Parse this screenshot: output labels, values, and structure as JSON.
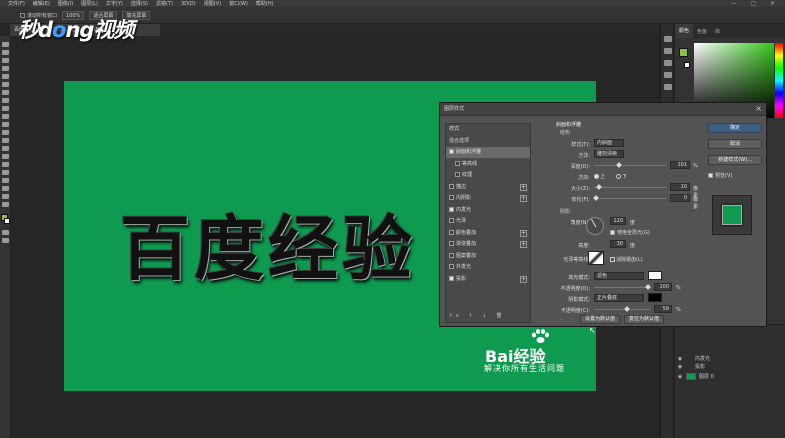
{
  "menubar": {
    "items": [
      "文件(F)",
      "编辑(E)",
      "图像(I)",
      "图层(L)",
      "文字(Y)",
      "选择(S)",
      "滤镜(T)",
      "3D(D)",
      "视图(V)",
      "窗口(W)",
      "帮助(H)"
    ],
    "window_controls": "— ▢ ✕"
  },
  "options": {
    "auto_scroll_label": "滚动所有窗口",
    "zoom_value": "100%",
    "fit_screen_label": "适合屏幕",
    "fill_screen_label": "填充屏幕"
  },
  "watermark": {
    "part1": "秒",
    "part2": "d",
    "part3": "o",
    "part4": "ng视频"
  },
  "document": {
    "tab_label": "百度经验.psd @ 100% (图层 1, RGB/8#) *"
  },
  "canvas": {
    "headline": "百度经验",
    "logo_text": "Bai经验",
    "slogan": "解决你所有生活问题",
    "background_color": "#0e9a4f"
  },
  "color_panel": {
    "tabs": [
      "颜色",
      "色板",
      "库"
    ],
    "foreground": "#8ac53f",
    "background": "#ffffff"
  },
  "layers": {
    "rows": [
      {
        "name": "内发光"
      },
      {
        "name": "投影"
      },
      {
        "name": "图层 0"
      }
    ]
  },
  "dialog": {
    "title": "图层样式",
    "close": "×",
    "styles_header": "样式",
    "blend_options": "混合选项",
    "styles": [
      {
        "label": "斜面和浮雕",
        "checked": true,
        "selected": true,
        "indent": false,
        "plus": false
      },
      {
        "label": "等高线",
        "checked": false,
        "selected": false,
        "indent": true,
        "plus": false
      },
      {
        "label": "纹理",
        "checked": false,
        "selected": false,
        "indent": true,
        "plus": false
      },
      {
        "label": "描边",
        "checked": false,
        "selected": false,
        "indent": false,
        "plus": true
      },
      {
        "label": "内阴影",
        "checked": false,
        "selected": false,
        "indent": false,
        "plus": true
      },
      {
        "label": "内发光",
        "checked": true,
        "selected": false,
        "indent": false,
        "plus": false
      },
      {
        "label": "光泽",
        "checked": false,
        "selected": false,
        "indent": false,
        "plus": false
      },
      {
        "label": "颜色叠加",
        "checked": false,
        "selected": false,
        "indent": false,
        "plus": true
      },
      {
        "label": "渐变叠加",
        "checked": false,
        "selected": false,
        "indent": false,
        "plus": true
      },
      {
        "label": "图案叠加",
        "checked": false,
        "selected": false,
        "indent": false,
        "plus": false
      },
      {
        "label": "外发光",
        "checked": false,
        "selected": false,
        "indent": false,
        "plus": false
      },
      {
        "label": "投影",
        "checked": true,
        "selected": false,
        "indent": false,
        "plus": true
      }
    ],
    "footer_icons": "fx ↑ ↓ 🗑",
    "section_title": "斜面和浮雕",
    "structure_title": "结构",
    "style_label": "样式(T):",
    "style_value": "内斜面",
    "technique_label": "方法:",
    "technique_value": "雕刻清晰",
    "depth_label": "深度(D):",
    "depth_value": "101",
    "depth_unit": "%",
    "direction_label": "方向:",
    "dir_up": "上",
    "dir_down": "下",
    "size_label": "大小(Z):",
    "size_value": "10",
    "size_unit": "像素",
    "soften_label": "软化(F):",
    "soften_value": "0",
    "soften_unit": "像素",
    "shading_title": "阴影",
    "angle_label": "角度(N):",
    "angle_value": "120",
    "angle_unit": "度",
    "global_light_label": "使用全局光(G)",
    "altitude_label": "高度:",
    "altitude_value": "30",
    "altitude_unit": "度",
    "gloss_label": "光泽等高线:",
    "antialias_label": "消除锯齿(L)",
    "highlight_mode_label": "高光模式:",
    "highlight_mode_value": "滤色",
    "highlight_opacity_label": "不透明度(O):",
    "highlight_opacity_value": "100",
    "highlight_color": "#ffffff",
    "shadow_mode_label": "阴影模式:",
    "shadow_mode_value": "正片叠底",
    "shadow_opacity_label": "不透明度(C):",
    "shadow_opacity_value": "59",
    "shadow_color": "#000000",
    "pct": "%",
    "set_default_label": "设置为默认值",
    "reset_default_label": "复位为默认值",
    "ok_label": "确定",
    "cancel_label": "取消",
    "new_style_label": "新建样式(W)...",
    "preview_label": "预览(V)",
    "depth_fraction": 0.34,
    "size_fraction": 0.04,
    "soften_fraction": 0.0,
    "highlight_opacity_fraction": 1.0,
    "shadow_opacity_fraction": 0.59
  }
}
